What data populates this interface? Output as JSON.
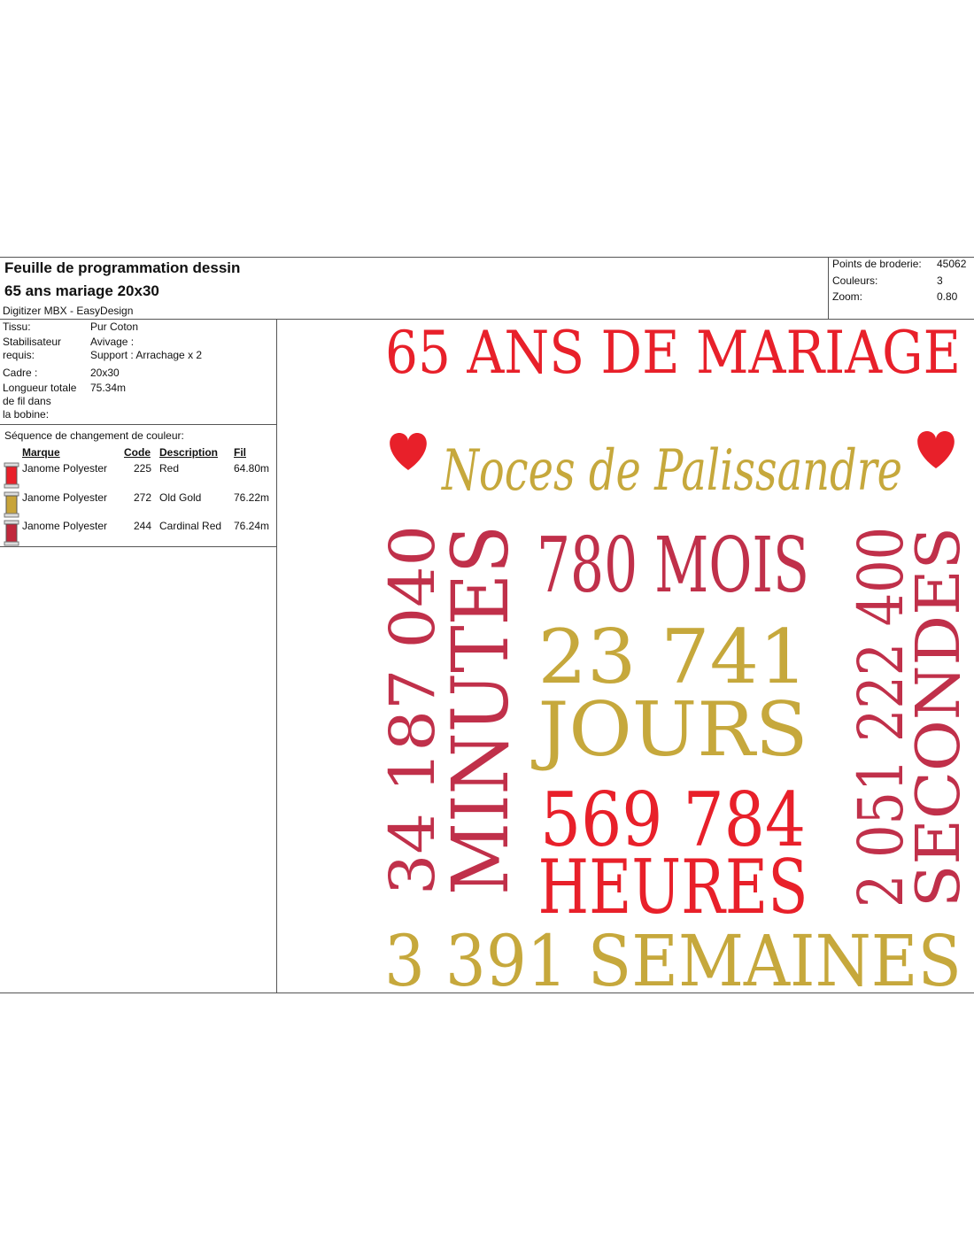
{
  "header": {
    "title": "Feuille de programmation dessin",
    "design_name": "65 ans mariage 20x30",
    "software": "Digitizer MBX - EasyDesign"
  },
  "stats": {
    "points_label": "Points de broderie:",
    "points_value": "45062",
    "colors_label": "Couleurs:",
    "colors_value": "3",
    "zoom_label": "Zoom:",
    "zoom_value": "0.80"
  },
  "info": {
    "tissu_label": "Tissu:",
    "tissu_value": "Pur Coton",
    "stab_label_1": "Stabilisateur",
    "stab_label_2": "requis:",
    "stab_value_1": "Avivage :",
    "stab_value_2": "Support : Arrachage x 2",
    "cadre_label": "Cadre :",
    "cadre_value": "20x30",
    "longueur_label_1": "Longueur totale",
    "longueur_label_2": "de fil dans",
    "longueur_label_3": "la bobine:",
    "longueur_value": "75.34m"
  },
  "sequence": {
    "title": "Séquence de changement de couleur:",
    "headers": {
      "brand": "Marque",
      "code": "Code",
      "description": "Description",
      "length": "Fil"
    },
    "threads": [
      {
        "brand": "Janome Polyester",
        "code": "225",
        "description": "Red",
        "length": "64.80m",
        "color": "#e8202a"
      },
      {
        "brand": "Janome Polyester",
        "code": "272",
        "description": "Old Gold",
        "length": "76.22m",
        "color": "#c8a43a"
      },
      {
        "brand": "Janome Polyester",
        "code": "244",
        "description": "Cardinal Red",
        "length": "76.24m",
        "color": "#c0283c"
      }
    ]
  },
  "design": {
    "title": "65 ANS DE MARIAGE",
    "subtitle": "Noces de Palissandre",
    "minutes_number": "34 187 040",
    "minutes_word": "MINUTES",
    "months": "780 MOIS",
    "days_number": "23 741",
    "days_word": "JOURS",
    "hours_number": "569 784",
    "hours_word": "HEURES",
    "seconds_number": "2 051 222 400",
    "seconds_word": "SECONDES",
    "weeks": "3 391 SEMAINES",
    "colors": {
      "red": "#e8202a",
      "gold": "#c6a83c",
      "cardinal": "#c0304a"
    }
  }
}
